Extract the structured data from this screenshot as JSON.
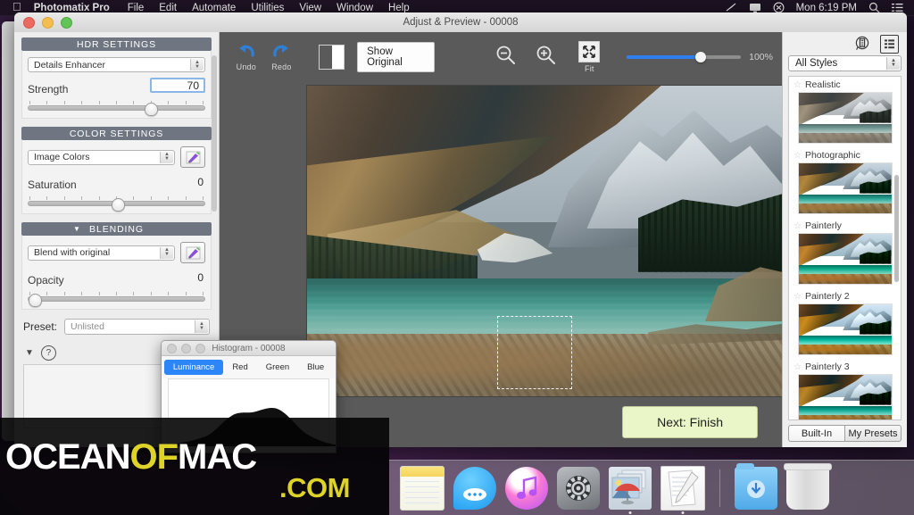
{
  "menubar": {
    "apple_icon": "apple-logo",
    "app_name": "Photomatix Pro",
    "items": [
      "File",
      "Edit",
      "Automate",
      "Utilities",
      "View",
      "Window",
      "Help"
    ],
    "right_icons": [
      "airplay-icon",
      "display-icon",
      "dropbox-icon"
    ],
    "clock": "Mon 6:19 PM",
    "search_icon": "search-icon",
    "notification_icon": "notification-center-icon"
  },
  "window": {
    "title": "Adjust & Preview - 00008",
    "traffic_lights": [
      "close",
      "minimize",
      "zoom"
    ]
  },
  "left_panel": {
    "hdr_settings": {
      "header": "HDR SETTINGS",
      "method": "Details Enhancer",
      "strength": {
        "label": "Strength",
        "value": "70",
        "knob_pct": 66
      }
    },
    "color_settings": {
      "header": "COLOR SETTINGS",
      "mode": "Image Colors",
      "brush_icon": "paintbrush-icon",
      "saturation": {
        "label": "Saturation",
        "value": "0",
        "knob_pct": 48
      }
    },
    "blending": {
      "header": "BLENDING",
      "chevron": "chevron-down-icon",
      "mode": "Blend with original",
      "brush_icon": "paintbrush-icon",
      "opacity": {
        "label": "Opacity",
        "value": "0",
        "knob_pct": 1
      }
    },
    "preset": {
      "label": "Preset:",
      "value": "Unlisted"
    },
    "help": {
      "chevron": "chevron-down-icon",
      "icon": "help-question-icon"
    }
  },
  "toolbar": {
    "undo": {
      "label": "Undo",
      "icon": "undo-arrow-icon"
    },
    "redo": {
      "label": "Redo",
      "icon": "redo-arrow-icon"
    },
    "split_view_icon": "split-view-icon",
    "show_original": "Show Original",
    "zoom_out_icon": "zoom-out-icon",
    "zoom_in_icon": "zoom-in-icon",
    "fit": {
      "label": "Fit",
      "icon": "fit-to-screen-icon"
    },
    "zoom_percent": "100%",
    "zoom_slider_pct": 60
  },
  "preview": {
    "image_alt": "mountain-lake-hdr-photo",
    "selection": "crop-selection-rectangle",
    "next_button": "Next: Finish"
  },
  "right_panel": {
    "view_icons": [
      "single-view-icon",
      "grid-view-icon"
    ],
    "style_filter": "All Styles",
    "presets": [
      {
        "name": "Realistic",
        "star": "star-icon"
      },
      {
        "name": "Photographic",
        "star": "star-icon"
      },
      {
        "name": "Painterly",
        "star": "star-icon"
      },
      {
        "name": "Painterly 2",
        "star": "star-icon"
      },
      {
        "name": "Painterly 3",
        "star": "star-icon"
      }
    ],
    "tabs": [
      {
        "label": "Built-In",
        "active": true
      },
      {
        "label": "My Presets",
        "active": false
      }
    ]
  },
  "histogram": {
    "title": "Histogram - 00008",
    "tabs": [
      {
        "label": "Luminance",
        "active": true
      },
      {
        "label": "Red",
        "active": false
      },
      {
        "label": "Green",
        "active": false
      },
      {
        "label": "Blue",
        "active": false
      }
    ]
  },
  "watermark": {
    "part1": "OCEAN",
    "part2": "OF",
    "part3": "MAC",
    "part4": ".COM",
    "accent_color": "#ded327"
  },
  "dock": {
    "items": [
      {
        "name": "Notes",
        "icon": "notes-icon",
        "running": false
      },
      {
        "name": "Messages",
        "icon": "messages-icon",
        "running": false
      },
      {
        "name": "iTunes",
        "icon": "itunes-icon",
        "running": false
      },
      {
        "name": "System Preferences",
        "icon": "system-preferences-icon",
        "running": false
      },
      {
        "name": "Photos",
        "icon": "photos-icon",
        "running": true
      },
      {
        "name": "TextEdit",
        "icon": "textedit-icon",
        "running": true
      },
      {
        "name": "Downloads",
        "icon": "downloads-folder-icon",
        "running": false
      },
      {
        "name": "Trash",
        "icon": "trash-icon",
        "running": false
      }
    ]
  },
  "colors": {
    "accent_blue": "#2d86f7",
    "section_header": "#6f7682",
    "next_button_bg": "#eaf5c8",
    "canvas_bg": "#5a5a5a"
  }
}
